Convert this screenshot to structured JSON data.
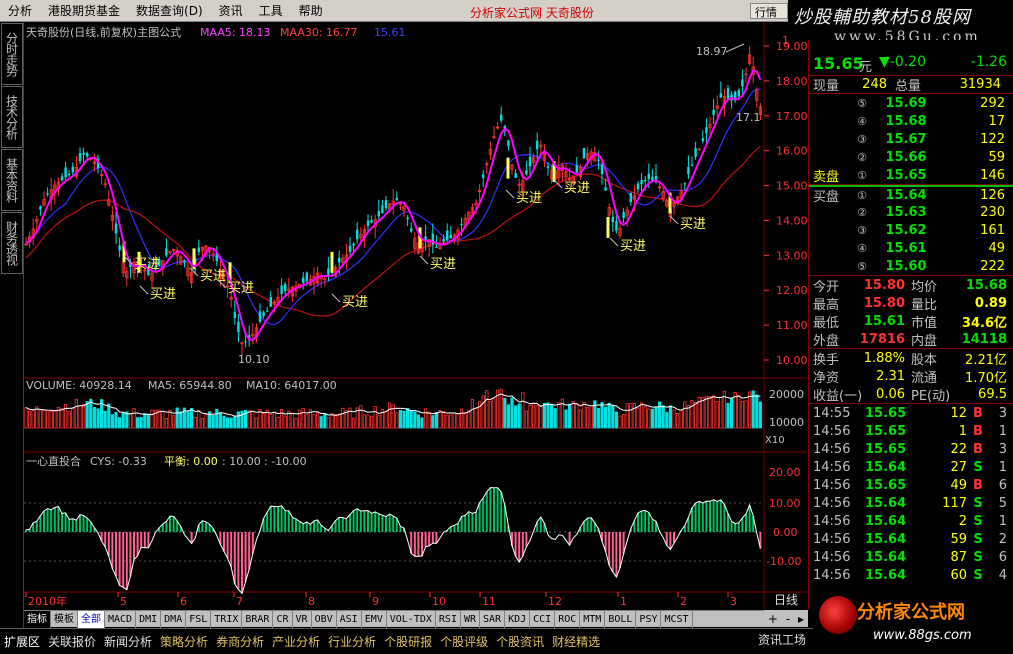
{
  "menu": {
    "items": [
      "分析",
      "港股期货基金",
      "数据查询(D)",
      "资讯",
      "工具",
      "帮助"
    ],
    "center_title": "分析家公式网  天奇股份",
    "row_btn": "行情",
    "logo_text": "炒股輔助教材58股网",
    "logo_url": "www.58Gu.com"
  },
  "left_tabs": [
    "分时走势",
    "技术分析",
    "基本资料",
    "财务透视"
  ],
  "main_chart": {
    "header": "天奇股份(日线,前复权)主图公式",
    "maa5": "MAA5: 18.13",
    "maa30": "MAA30: 16.77",
    "third": "15.61",
    "y_ticks": [
      "19.00",
      "18.00",
      "17.00",
      "16.00",
      "15.00",
      "14.00",
      "13.00",
      "12.00",
      "11.00",
      "10.00"
    ],
    "high_label": "18.97",
    "low_label": "10.10",
    "last_label": "17.1",
    "buy_label": "买进",
    "top_right_tick": "1"
  },
  "volume_chart": {
    "volume": "VOLUME: 40928.14",
    "ma5": "MA5: 65944.80",
    "ma10": "MA10: 64017.00",
    "y_ticks": [
      "20000",
      "10000"
    ],
    "unit": "X10"
  },
  "cys_chart": {
    "title": "一心直投合",
    "cys": "CYS: -0.33",
    "pingheng": "平衡: 0.00",
    "v2": ": 10.00",
    "v3": ": -10.00",
    "y_ticks": [
      "20.00",
      "10.00",
      "0.00",
      "-10.00"
    ]
  },
  "x_axis": {
    "labels": [
      "2010年",
      "5",
      "6",
      "7",
      "8",
      "9",
      "10",
      "11",
      "12",
      "1",
      "2",
      "3"
    ],
    "period": "日线"
  },
  "quote": {
    "price": "15.65",
    "unit": "元",
    "change": "▼-0.20",
    "pct": "-1.26",
    "xianliang_label": "现量",
    "xianliang": "248",
    "zongliang_label": "总量",
    "zongliang": "31934",
    "sell": [
      {
        "num": "⑤",
        "price": "15.69",
        "vol": "292"
      },
      {
        "num": "④",
        "price": "15.68",
        "vol": "17"
      },
      {
        "num": "③",
        "price": "15.67",
        "vol": "122"
      },
      {
        "num": "②",
        "price": "15.66",
        "vol": "59"
      },
      {
        "label": "卖盘",
        "num": "①",
        "price": "15.65",
        "vol": "146"
      }
    ],
    "buy": [
      {
        "label": "买盘",
        "num": "①",
        "price": "15.64",
        "vol": "126"
      },
      {
        "num": "②",
        "price": "15.63",
        "vol": "230"
      },
      {
        "num": "③",
        "price": "15.62",
        "vol": "161"
      },
      {
        "num": "④",
        "price": "15.61",
        "vol": "49"
      },
      {
        "num": "⑤",
        "price": "15.60",
        "vol": "222"
      }
    ],
    "stats": [
      {
        "k": "今开",
        "v": "15.80",
        "k2": "均价",
        "v2": "15.68"
      },
      {
        "k": "最高",
        "v": "15.80",
        "k2": "量比",
        "v2": "0.89"
      },
      {
        "k": "最低",
        "v": "15.61",
        "k2": "市值",
        "v2": "34.6亿"
      },
      {
        "k": "外盘",
        "v": "17816",
        "k2": "内盘",
        "v2": "14118"
      }
    ],
    "stats2": [
      {
        "k": "换手",
        "v": "1.88%",
        "k2": "股本",
        "v2": "2.21亿"
      },
      {
        "k": "净资",
        "v": "2.31",
        "k2": "流通",
        "v2": "1.70亿"
      },
      {
        "k": "收益(一)",
        "v": "0.06",
        "k2": "PE(动)",
        "v2": "69.5"
      }
    ],
    "ticks": [
      {
        "t": "14:55",
        "p": "15.65",
        "v": "12",
        "bs": "B",
        "n": "3"
      },
      {
        "t": "14:56",
        "p": "15.65",
        "v": "1",
        "bs": "B",
        "n": "1"
      },
      {
        "t": "14:56",
        "p": "15.65",
        "v": "22",
        "bs": "B",
        "n": "3"
      },
      {
        "t": "14:56",
        "p": "15.64",
        "v": "27",
        "bs": "S",
        "n": "1"
      },
      {
        "t": "14:56",
        "p": "15.65",
        "v": "49",
        "bs": "B",
        "n": "6"
      },
      {
        "t": "14:56",
        "p": "15.64",
        "v": "117",
        "bs": "S",
        "n": "5"
      },
      {
        "t": "14:56",
        "p": "15.64",
        "v": "2",
        "bs": "S",
        "n": "1"
      },
      {
        "t": "14:56",
        "p": "15.64",
        "v": "59",
        "bs": "S",
        "n": "2"
      },
      {
        "t": "14:56",
        "p": "15.64",
        "v": "87",
        "bs": "S",
        "n": "6"
      },
      {
        "t": "14:56",
        "p": "15.64",
        "v": "60",
        "bs": "S",
        "n": "4"
      }
    ]
  },
  "indicator_tabs": [
    "指标",
    "模板",
    "全部",
    "MACD",
    "DMI",
    "DMA",
    "FSL",
    "TRIX",
    "BRAR",
    "CR",
    "VR",
    "OBV",
    "ASI",
    "EMV",
    "VOL-TDX",
    "RSI",
    "WR",
    "SAR",
    "KDJ",
    "CCI",
    "ROC",
    "MTM",
    "BOLL",
    "PSY",
    "MCST"
  ],
  "scroll": {
    "plus": "+",
    "minus": "-",
    "arrow": "▸"
  },
  "bottom_bar": [
    "扩展区",
    "关联报价",
    "新闻分析",
    "策略分析",
    "券商分析",
    "产业分析",
    "行业分析",
    "个股研报",
    "个股评级",
    "个股资讯",
    "财经精选"
  ],
  "bottom_right": "资讯工场",
  "brand": {
    "title": "分析家公式网",
    "url": "www.88gs.com"
  },
  "colors": {
    "up": "#ff3030",
    "down": "#00e0e0",
    "ma5": "#ff00ff",
    "ma30": "#d01010",
    "ma3": "#3030ff",
    "buy": "#ffff60"
  }
}
